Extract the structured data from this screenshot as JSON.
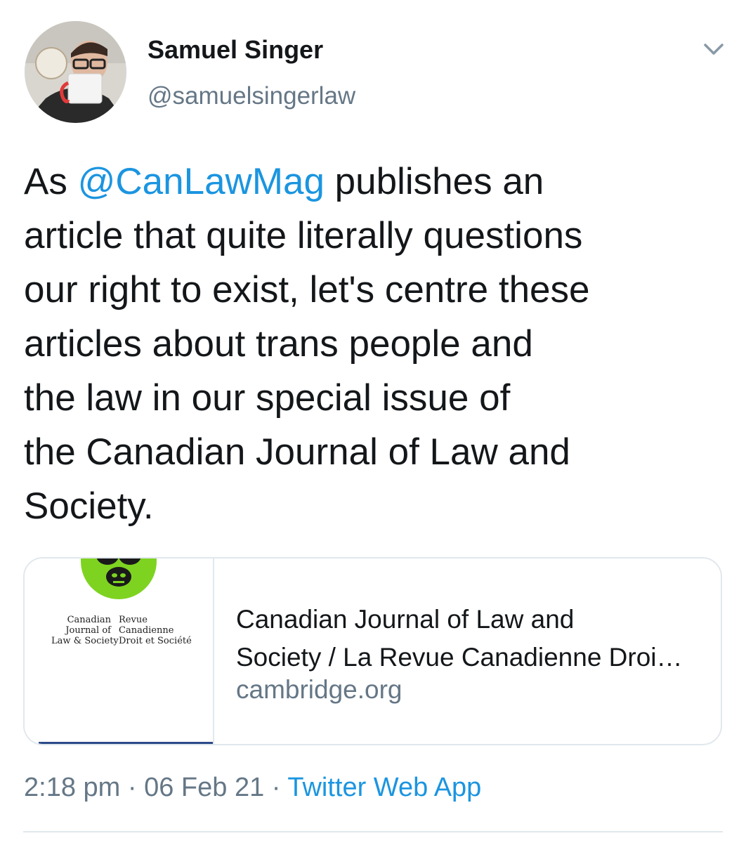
{
  "author": {
    "display_name": "Samuel Singer",
    "handle": "@samuelsingerlaw"
  },
  "tweet": {
    "lines": [
      {
        "mention": "@CanLawMag",
        "pre": "As ",
        "post": " publishes an"
      },
      "article that quite literally questions",
      "our right to exist, let's centre these",
      "articles about trans people and",
      "the law in our special issue of",
      "the Canadian Journal of Law and",
      "Society."
    ]
  },
  "card": {
    "thumbnail_lines_left": [
      "Canadian",
      "Journal of",
      "Law & Society"
    ],
    "thumbnail_lines_right": [
      "Revue",
      "Canadienne",
      "Droit et Société"
    ],
    "title_line_1": "Canadian Journal of Law and",
    "title_line_2": "Society / La Revue Canadienne Droi…",
    "domain": "cambridge.org"
  },
  "meta": {
    "time": "2:18 pm",
    "separator": " · ",
    "date": "06 Feb 21",
    "source": "Twitter Web App"
  },
  "colors": {
    "link": "#1b95e0",
    "secondary_text": "#657786",
    "border": "#e1e8ed",
    "logo_green": "#7ed321"
  },
  "icons": {
    "caret": "chevron-down-icon"
  }
}
